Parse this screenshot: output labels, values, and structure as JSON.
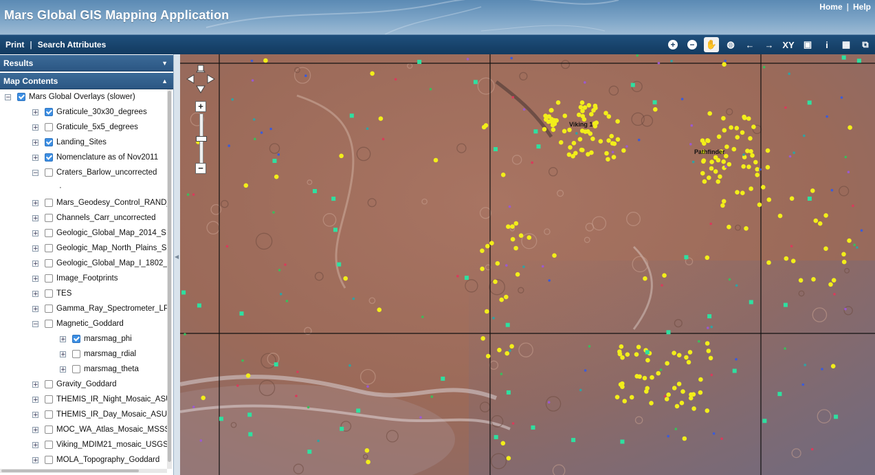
{
  "header": {
    "title": "Mars Global GIS Mapping Application",
    "links": [
      "Home",
      "Help"
    ]
  },
  "toolbar": {
    "menu": [
      "Print",
      "Search Attributes"
    ],
    "tools": [
      {
        "name": "zoom-in-icon",
        "glyph": "+"
      },
      {
        "name": "zoom-out-icon",
        "glyph": "−"
      },
      {
        "name": "pan-hand-icon",
        "glyph": "✋"
      },
      {
        "name": "full-extent-globe-icon",
        "glyph": "◍"
      },
      {
        "name": "previous-extent-icon",
        "glyph": "←"
      },
      {
        "name": "next-extent-icon",
        "glyph": "→"
      },
      {
        "name": "go-to-xy-icon",
        "glyph": "XY"
      },
      {
        "name": "layer-extent-icon",
        "glyph": "▣"
      },
      {
        "name": "identify-icon",
        "glyph": "i"
      },
      {
        "name": "measure-icon",
        "glyph": "▦"
      },
      {
        "name": "overview-icon",
        "glyph": "⧉"
      }
    ]
  },
  "panels": {
    "results": "Results",
    "map_contents": "Map Contents"
  },
  "tree": [
    {
      "label": "Mars Global Overlays (slower)",
      "level": 0,
      "checked": true,
      "expander": "−"
    },
    {
      "label": "Graticule_30x30_degrees",
      "level": 1,
      "checked": true,
      "expander": "+"
    },
    {
      "label": "Graticule_5x5_degrees",
      "level": 1,
      "checked": false,
      "expander": "+"
    },
    {
      "label": "Landing_Sites",
      "level": 1,
      "checked": true,
      "expander": "+"
    },
    {
      "label": "Nomenclature as of Nov2011",
      "level": 1,
      "checked": true,
      "expander": "+"
    },
    {
      "label": "Craters_Barlow_uncorrected",
      "level": 1,
      "checked": false,
      "expander": "−"
    },
    {
      "label": "·",
      "level": 2,
      "checked": null,
      "expander": null
    },
    {
      "label": "Mars_Geodesy_Control_RAND_",
      "level": 1,
      "checked": false,
      "expander": "+"
    },
    {
      "label": "Channels_Carr_uncorrected",
      "level": 1,
      "checked": false,
      "expander": "+"
    },
    {
      "label": "Geologic_Global_Map_2014_S",
      "level": 1,
      "checked": false,
      "expander": "+"
    },
    {
      "label": "Geologic_Map_North_Plains_S",
      "level": 1,
      "checked": false,
      "expander": "+"
    },
    {
      "label": "Geologic_Global_Map_I_1802_",
      "level": 1,
      "checked": false,
      "expander": "+"
    },
    {
      "label": "Image_Footprints",
      "level": 1,
      "checked": false,
      "expander": "+"
    },
    {
      "label": "TES",
      "level": 1,
      "checked": false,
      "expander": "+"
    },
    {
      "label": "Gamma_Ray_Spectrometer_LP",
      "level": 1,
      "checked": false,
      "expander": "+"
    },
    {
      "label": "Magnetic_Goddard",
      "level": 1,
      "checked": false,
      "expander": "−"
    },
    {
      "label": "marsmag_phi",
      "level": 2,
      "checked": true,
      "expander": "+"
    },
    {
      "label": "marsmag_rdial",
      "level": 2,
      "checked": false,
      "expander": "+"
    },
    {
      "label": "marsmag_theta",
      "level": 2,
      "checked": false,
      "expander": "+"
    },
    {
      "label": "Gravity_Goddard",
      "level": 1,
      "checked": false,
      "expander": "+"
    },
    {
      "label": "THEMIS_IR_Night_Mosaic_ASU",
      "level": 1,
      "checked": false,
      "expander": "+"
    },
    {
      "label": "THEMIS_IR_Day_Mosaic_ASU",
      "level": 1,
      "checked": false,
      "expander": "+"
    },
    {
      "label": "MOC_WA_Atlas_Mosaic_MSSS",
      "level": 1,
      "checked": false,
      "expander": "+"
    },
    {
      "label": "Viking_MDIM21_mosaic_USGS",
      "level": 1,
      "checked": false,
      "expander": "+"
    },
    {
      "label": "MOLA_Topography_Goddard",
      "level": 1,
      "checked": false,
      "expander": "+"
    }
  ],
  "map": {
    "labels": [
      "Viking 1",
      "Pathfinder"
    ],
    "colors": {
      "surface": "#9a6a5a",
      "feature": "#f2ee1a",
      "landing": "#2ee0a0",
      "graticule": "#111111"
    }
  }
}
